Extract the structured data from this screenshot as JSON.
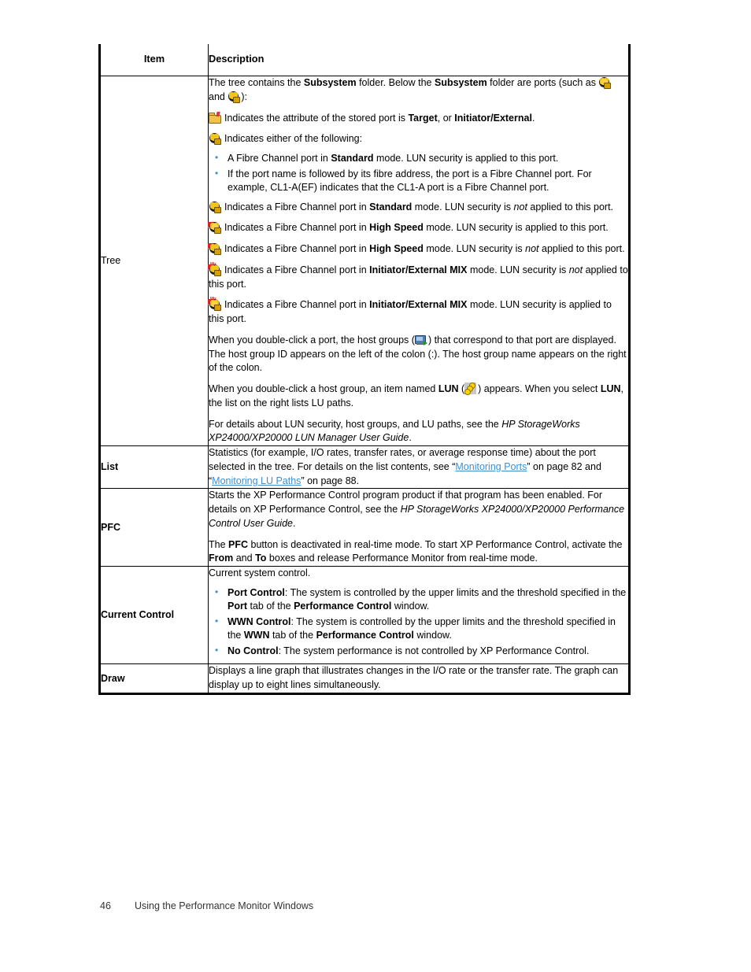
{
  "table": {
    "header": {
      "item": "Item",
      "description": "Description"
    },
    "rows": [
      {
        "item": "Tree",
        "item_bold": false,
        "blocks": [
          {
            "intro_1": "The tree contains the ",
            "b1": "Subsystem",
            "intro_2": " folder. Below the ",
            "b2": "Subsystem",
            "intro_3": " folder are ports (such as ",
            "icon_a": "port-standard-secured-icon",
            "intro_4": " and ",
            "icon_b": "port-standard-icon",
            "intro_5": "):"
          },
          {
            "icon": "folder-stored-port-icon",
            "t1": "Indicates the attribute of the stored port is ",
            "b1": "Target",
            "t2": ", or ",
            "b2": "Initiator/External",
            "t3": "."
          },
          {
            "icon": "port-standard-icon",
            "t1": "Indicates either of the following:",
            "bullets": [
              {
                "t1": "A Fibre Channel port in ",
                "b1": "Standard",
                "t2": " mode. LUN security is applied to this port."
              },
              {
                "t1": "If the port name is followed by its fibre address, the port is a Fibre Channel port. For example, CL1-A(EF) indicates that the CL1-A port is a Fibre Channel port."
              }
            ]
          },
          {
            "icon": "port-standard-unsecured-icon",
            "t1": "Indicates a Fibre Channel port in ",
            "b1": "Standard",
            "t2": " mode. LUN security is ",
            "i1": "not",
            "t3": " applied to this port."
          },
          {
            "icon": "port-highspeed-secured-icon",
            "t1": "Indicates a Fibre Channel port in ",
            "b1": "High Speed",
            "t2": " mode. LUN security is applied to this port."
          },
          {
            "icon": "port-highspeed-unsecured-icon",
            "t1": "Indicates a Fibre Channel port in ",
            "b1": "High Speed",
            "t2": " mode. LUN security is ",
            "i1": "not",
            "t3": " applied to this port."
          },
          {
            "icon": "port-mix-unsecured-icon",
            "t1": "Indicates a Fibre Channel port in ",
            "b1": "Initiator/External MIX",
            "t2": " mode. LUN security is ",
            "i1": "not",
            "t3": " applied to this port."
          },
          {
            "icon": "port-mix-secured-icon",
            "t1": "Indicates a Fibre Channel port in ",
            "b1": "Initiator/External MIX",
            "t2": " mode. LUN security is applied to this port."
          },
          {
            "t1": "When you double-click a port, the host groups (",
            "icon": "host-group-icon",
            "t2": ") that correspond to that port are displayed. The host group ID appears on the left of the colon (:). The host group name appears on the right of the colon."
          },
          {
            "t1": "When you double-click a host group, an item named ",
            "b1": "LUN",
            "t2": " (",
            "icon": "lun-icon",
            "t3": ") appears. When you select ",
            "b2": "LUN",
            "t4": ", the list on the right lists LU paths."
          },
          {
            "t1": "For details about LUN security, host groups, and LU paths, see the ",
            "i1": "HP StorageWorks XP24000/XP20000 LUN Manager User Guide",
            "t2": "."
          }
        ]
      },
      {
        "item": "List",
        "item_bold": true,
        "blocks": [
          {
            "t1": "Statistics (for example, I/O rates, transfer rates, or average response time) about the port selected in the tree. For details on the list contents, see “",
            "link1": "Monitoring Ports",
            "t2": "” on page 82 and “",
            "link2": "Monitoring LU Paths",
            "t3": "” on page 88."
          }
        ]
      },
      {
        "item": "PFC",
        "item_bold": true,
        "blocks": [
          {
            "t1": "Starts the XP Performance Control program product if that program has been enabled. For details on XP Performance Control, see the ",
            "i1": "HP StorageWorks XP24000/XP20000 Performance Control User Guide",
            "t2": "."
          },
          {
            "t1": "The ",
            "b1": "PFC",
            "t2": " button is deactivated in real-time mode. To start XP Performance Control, activate the ",
            "b2": "From",
            "t3": " and ",
            "b3": "To",
            "t4": " boxes and release Performance Monitor from real-time mode."
          }
        ]
      },
      {
        "item": "Current Control",
        "item_bold": true,
        "blocks": [
          {
            "t1": "Current system control."
          }
        ],
        "bullets": [
          {
            "b1": "Port Control",
            "t1": ": The system is controlled by the upper limits and the threshold specified in the ",
            "b2": "Port",
            "t2": " tab of the ",
            "b3": "Performance Control",
            "t3": " window."
          },
          {
            "b1": "WWN Control",
            "t1": ": The system is controlled by the upper limits and the threshold specified in the ",
            "b2": "WWN",
            "t2": " tab of the ",
            "b3": "Performance Control",
            "t3": " window."
          },
          {
            "b1": "No Control",
            "t1": ": The system performance is not controlled by XP Performance Control."
          }
        ]
      },
      {
        "item": "Draw",
        "item_bold": true,
        "blocks": [
          {
            "t1": "Displays a line graph that illustrates changes in the I/O rate or the transfer rate. The graph can display up to eight lines simultaneously."
          }
        ]
      }
    ]
  },
  "footer": {
    "page_number": "46",
    "chapter_title": "Using the Performance Monitor Windows"
  },
  "colors": {
    "link": "#3f8fd0",
    "bullet": "#3f8fd0",
    "rule": "#000000"
  }
}
